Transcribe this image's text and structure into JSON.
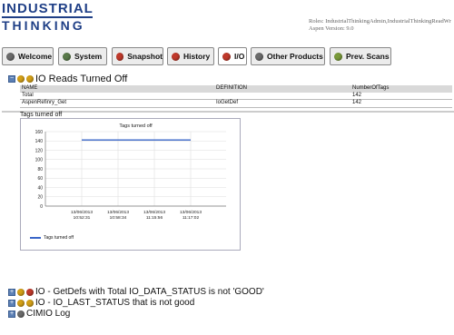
{
  "brand": {
    "line1": "INDUSTRIAL",
    "line2": "THINKING",
    "color": "#1f3f86"
  },
  "header": {
    "roles": "Roles: IndustrialThinkingAdmin,IndustrialThinkingReadWr",
    "version": "Aspen Version: 9.0"
  },
  "tabs": [
    {
      "label": "Welcome",
      "dot": "#6b6b6b"
    },
    {
      "label": "System",
      "dot": "#5a7a4a"
    },
    {
      "label": "Snapshot",
      "dot": "#c0392b"
    },
    {
      "label": "History",
      "dot": "#c0392b"
    },
    {
      "label": "I/O",
      "dot": "#c0392b",
      "active": true
    },
    {
      "label": "Other Products",
      "dot": "#6b6b6b"
    },
    {
      "label": "Prev. Scans",
      "dot": "#7a9a3a"
    }
  ],
  "io_reads": {
    "title": "IO Reads Turned Off",
    "columns": [
      "NAME",
      "DEFINITION",
      "NumberOfTags"
    ],
    "rows": [
      [
        "Total",
        "",
        "142"
      ],
      [
        "AspenRefinry_Get",
        "IoGetDef",
        "142"
      ]
    ],
    "caption": "Tags turned off"
  },
  "chart_data": {
    "type": "line",
    "title": "Tags turned off",
    "x": [
      "13/06/2013 10:52:31",
      "13/06/2013 10:58:34",
      "13/06/2013 11:15:56",
      "13/06/2013 11:17:02"
    ],
    "x_tick_labels": [
      [
        "13/06/2013",
        "10:52:31"
      ],
      [
        "13/06/2013",
        "10:58:34"
      ],
      [
        "13/06/2013",
        "11:15:56"
      ],
      [
        "13/06/2013",
        "11:17:02"
      ]
    ],
    "series": [
      {
        "name": "Tags turned off",
        "values": [
          142,
          142,
          142,
          142
        ],
        "color": "#3a66c8"
      }
    ],
    "ylim": [
      0,
      160
    ],
    "yticks": [
      0,
      20,
      40,
      60,
      80,
      100,
      120,
      140,
      160
    ],
    "grid": true,
    "legend": "bottom-left"
  },
  "sections": [
    {
      "label": "IO - GetDefs with Total IO_DATA_STATUS is not 'GOOD'",
      "dot": "#c0392b"
    },
    {
      "label": "IO - IO_LAST_STATUS that is not good",
      "dot": "#d4a017"
    },
    {
      "label": "CIMIO Log",
      "dot": "#6b6b6b"
    }
  ],
  "section_dots": {
    "io_reads": [
      "#d4a017",
      "#d4a017"
    ]
  }
}
